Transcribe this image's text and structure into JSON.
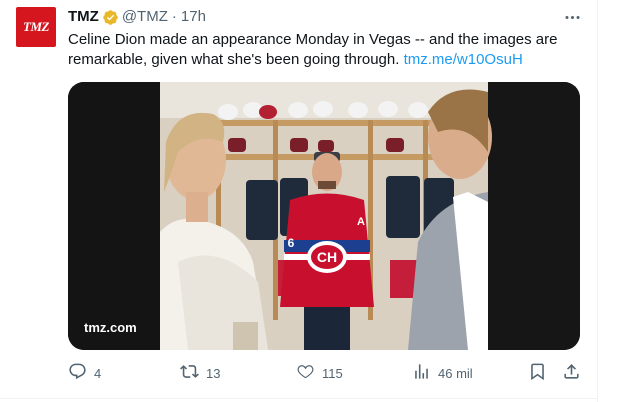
{
  "tweet": {
    "avatar_text": "TMZ",
    "display_name": "TMZ",
    "handle": "@TMZ",
    "separator": "·",
    "time": "17h",
    "body": "Celine Dion made an appearance Monday in Vegas -- and the images are remarkable, given what she's been going through.",
    "link": "tmz.me/w10OsuH",
    "media": {
      "watermark": "tmz.com",
      "jersey_number": "6",
      "jersey_letter": "A",
      "logo_text": "CH"
    }
  },
  "actions": {
    "replies": "4",
    "retweets": "13",
    "likes": "115",
    "views": "46 mil"
  },
  "icons": {
    "verified": "verified-badge-icon",
    "more": "more-icon",
    "reply": "reply-icon",
    "retweet": "retweet-icon",
    "like": "like-icon",
    "views": "views-icon",
    "bookmark": "bookmark-icon",
    "share": "share-icon"
  },
  "colors": {
    "accent": "#1d9bf0",
    "verified_gold": "#e8b829",
    "avatar_red": "#d6161f",
    "muted": "#536471"
  }
}
